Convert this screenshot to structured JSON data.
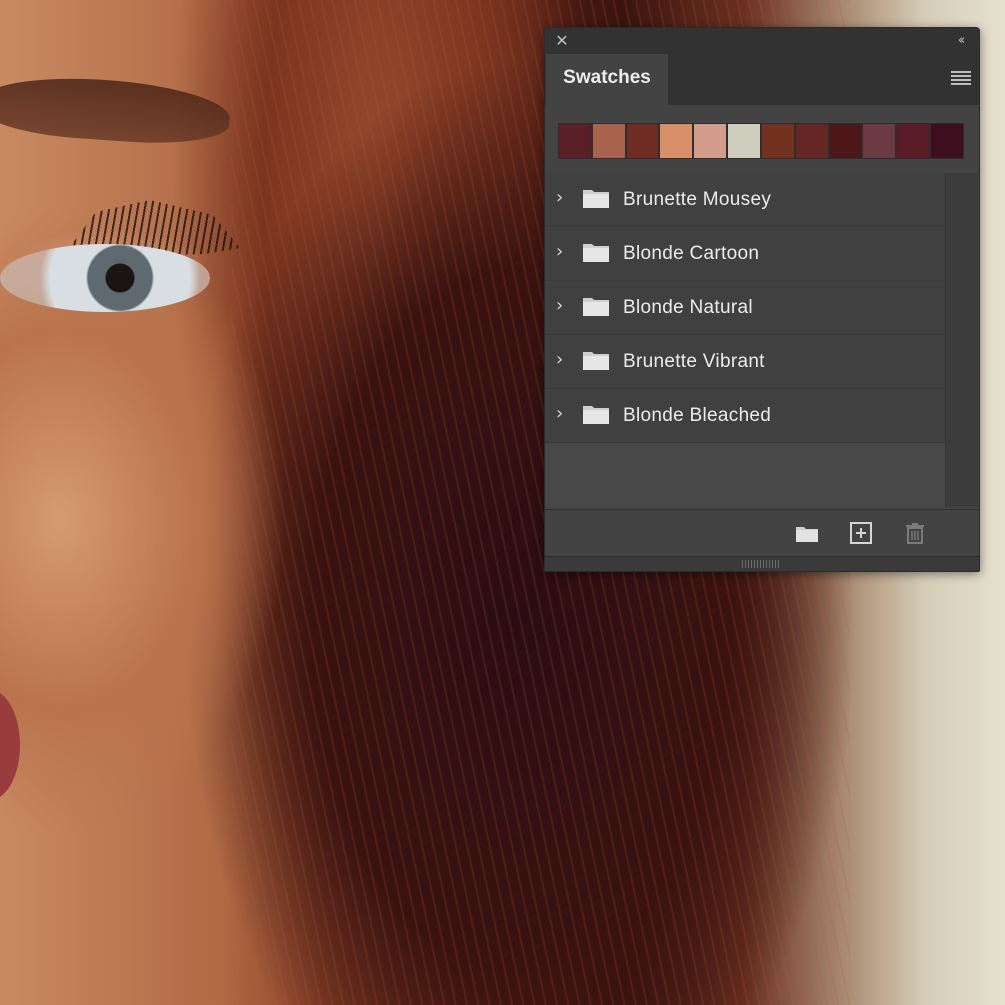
{
  "panel": {
    "tab_label": "Swatches",
    "close_icon": "close-icon",
    "collapse_icon": "double-chevron-left-icon",
    "menu_icon": "panel-menu-icon"
  },
  "swatches": [
    {
      "color": "#5a1f27"
    },
    {
      "color": "#a8634e"
    },
    {
      "color": "#6e2c24"
    },
    {
      "color": "#d88e67"
    },
    {
      "color": "#d29c8b"
    },
    {
      "color": "#cfcebe"
    },
    {
      "color": "#73311f"
    },
    {
      "color": "#662625"
    },
    {
      "color": "#4d1618"
    },
    {
      "color": "#6b3a43"
    },
    {
      "color": "#5a1d27"
    },
    {
      "color": "#3d0e1e"
    }
  ],
  "groups": [
    {
      "label": "Brunette Mousey"
    },
    {
      "label": "Blonde Cartoon"
    },
    {
      "label": "Blonde Natural"
    },
    {
      "label": "Brunette Vibrant"
    },
    {
      "label": "Blonde Bleached"
    }
  ],
  "footer": {
    "icons": [
      "new-group-folder-icon",
      "new-swatch-icon",
      "trash-icon"
    ]
  }
}
